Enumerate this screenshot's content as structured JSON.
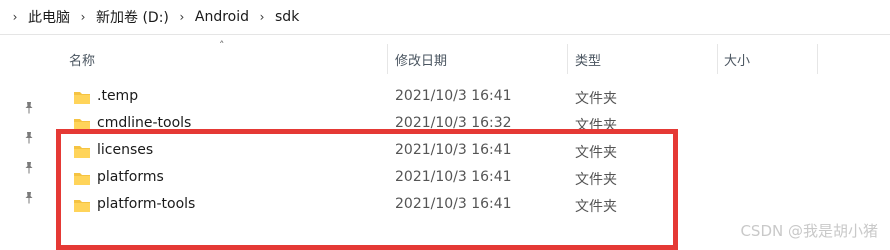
{
  "breadcrumb": [
    "此电脑",
    "新加卷 (D:)",
    "Android",
    "sdk"
  ],
  "columns": {
    "name": "名称",
    "date": "修改日期",
    "type": "类型",
    "size": "大小"
  },
  "rows": [
    {
      "name": ".temp",
      "date": "2021/10/3 16:41",
      "type": "文件夹"
    },
    {
      "name": "cmdline-tools",
      "date": "2021/10/3 16:32",
      "type": "文件夹"
    },
    {
      "name": "licenses",
      "date": "2021/10/3 16:41",
      "type": "文件夹"
    },
    {
      "name": "platforms",
      "date": "2021/10/3 16:41",
      "type": "文件夹"
    },
    {
      "name": "platform-tools",
      "date": "2021/10/3 16:41",
      "type": "文件夹"
    }
  ],
  "watermark": "CSDN @我是胡小猪",
  "colors": {
    "folder": "#f5c342",
    "highlight": "#e53935"
  },
  "icons": [
    "chevron-right-icon",
    "pin-icon",
    "folder-icon",
    "sort-up-icon"
  ]
}
